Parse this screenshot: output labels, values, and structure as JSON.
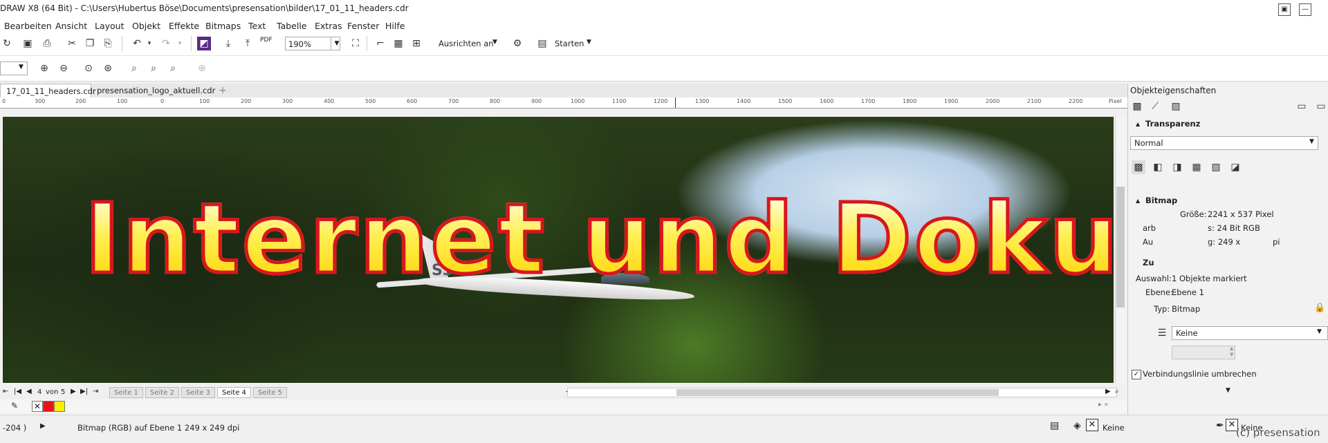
{
  "window": {
    "title": "DRAW X8 (64 Bit) - C:\\Users\\Hubertus Böse\\Documents\\presensation\\bilder\\17_01_11_headers.cdr"
  },
  "menu": [
    "Bearbeiten",
    "Ansicht",
    "Layout",
    "Objekt",
    "Effekte",
    "Bitmaps",
    "Text",
    "Tabelle",
    "Extras",
    "Fenster",
    "Hilfe"
  ],
  "toolbar": {
    "pdf_label": "PDF",
    "zoom_value": "190%",
    "snap_label": "Ausrichten an",
    "launch_label": "Starten"
  },
  "tabs": [
    "17_01_11_headers.cdr",
    "presensation_logo_aktuell.cdr"
  ],
  "ruler": {
    "labels": [
      "0",
      "300",
      "200",
      "100",
      "0",
      "100",
      "200",
      "300",
      "400",
      "500",
      "600",
      "700",
      "800",
      "900",
      "1000",
      "1100",
      "1200",
      "1300",
      "1400",
      "1500",
      "1600",
      "1700",
      "1800",
      "1900",
      "2000",
      "2100",
      "2200"
    ],
    "unit": "Pixel"
  },
  "canvas": {
    "headline": "Internet und Doku",
    "glider_code": "S3"
  },
  "page_nav": {
    "current": "4",
    "of_label": "von",
    "total": "5",
    "pages": [
      "Seite 1",
      "Seite 2",
      "Seite 3",
      "Seite 4",
      "Seite 5"
    ],
    "active_index": 3
  },
  "palette": {
    "colors": [
      "#e8141c",
      "#ffee00"
    ]
  },
  "status": {
    "coords": "-204  )",
    "object_info": "Bitmap (RGB) auf Ebene 1 249 x 249 dpi",
    "fill_label": "Keine",
    "outline_label": "Keine"
  },
  "panel": {
    "title": "Objekteigenschaften",
    "transparency": {
      "heading": "Transparenz",
      "mode": "Normal"
    },
    "bitmap": {
      "heading": "Bitmap",
      "size_label": "Größe:",
      "size_value": "2241 x 537 Pixel",
      "color_label": "arb",
      "color_value": "s: 24 Bit RGB",
      "res_label": "Au",
      "res_value": "g: 249 x",
      "res_tail": "pi"
    },
    "summary": {
      "heading": "Zu",
      "selection_label": "Auswahl:",
      "selection_value": "1 Objekte markiert",
      "layer_label": "Ebene:",
      "layer_value": "Ebene 1",
      "type_label": "Typ:",
      "type_value": "Bitmap"
    },
    "wrap_dropdown": "Keine",
    "wrap_checkbox_label": "Verbindungslinie umbrechen"
  },
  "watermark": "(c) presensation"
}
